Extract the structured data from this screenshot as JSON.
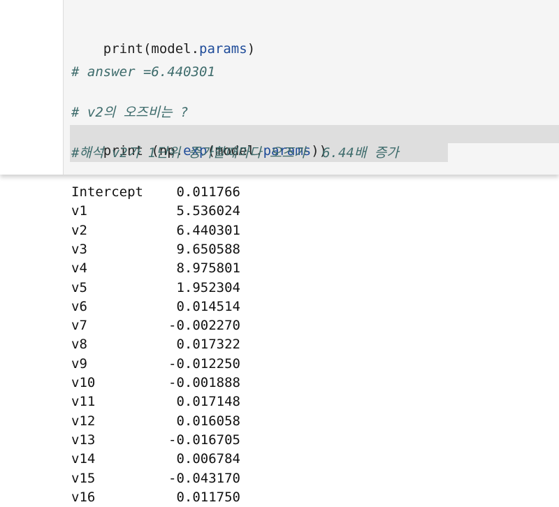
{
  "code_cell": {
    "line1": {
      "prefix": "print(model.",
      "attr": "params",
      "suffix": ")"
    },
    "line2": "# answer =6.440301",
    "line3": "# v2의 오즈비는 ?",
    "line4": {
      "prefix": "print (np.",
      "func": "exp",
      "mid": "(model.",
      "attr": "params",
      "suffix": "))"
    },
    "line5": "#해석 v2가 1단위 증가할때마다 오즈가  6.44배 증가"
  },
  "output": {
    "rows": [
      {
        "name": "Intercept",
        "value": "0.011766"
      },
      {
        "name": "v1",
        "value": "5.536024"
      },
      {
        "name": "v2",
        "value": "6.440301"
      },
      {
        "name": "v3",
        "value": "9.650588"
      },
      {
        "name": "v4",
        "value": "8.975801"
      },
      {
        "name": "v5",
        "value": "1.952304"
      },
      {
        "name": "v6",
        "value": "0.014514"
      },
      {
        "name": "v7",
        "value": "-0.002270"
      },
      {
        "name": "v8",
        "value": "0.017322"
      },
      {
        "name": "v9",
        "value": "-0.012250"
      },
      {
        "name": "v10",
        "value": "-0.001888"
      },
      {
        "name": "v11",
        "value": "0.017148"
      },
      {
        "name": "v12",
        "value": "0.016058"
      },
      {
        "name": "v13",
        "value": "-0.016705"
      },
      {
        "name": "v14",
        "value": "0.006784"
      },
      {
        "name": "v15",
        "value": "-0.043170"
      },
      {
        "name": "v16",
        "value": "0.011750"
      }
    ]
  },
  "colors": {
    "cell_background": "#f5f5f5",
    "selection": "#dedede",
    "attribute": "#1e4b99",
    "comment": "#3d6b6b"
  }
}
